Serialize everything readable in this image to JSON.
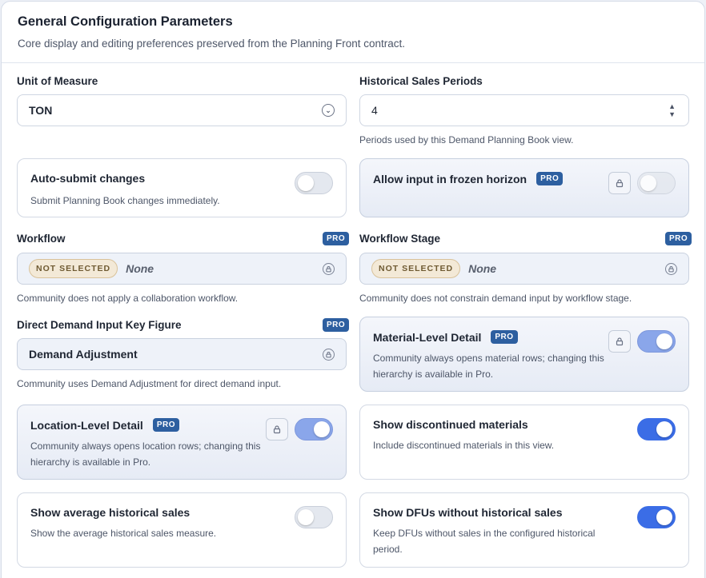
{
  "header": {
    "title": "General Configuration Parameters",
    "subtitle": "Core display and editing preferences preserved from the Planning Front contract."
  },
  "pro_label": "PRO",
  "unit_of_measure": {
    "label": "Unit of Measure",
    "value": "TON"
  },
  "historical_sales_periods": {
    "label": "Historical Sales Periods",
    "value": "4",
    "help": "Periods used by this Demand Planning Book view."
  },
  "auto_submit": {
    "title": "Auto-submit changes",
    "desc": "Submit Planning Book changes immediately.",
    "enabled": false
  },
  "frozen_horizon": {
    "title": "Allow input in frozen horizon",
    "enabled": false,
    "locked": true
  },
  "workflow": {
    "label": "Workflow",
    "status": "NOT SELECTED",
    "value": "None",
    "help": "Community does not apply a collaboration workflow."
  },
  "workflow_stage": {
    "label": "Workflow Stage",
    "status": "NOT SELECTED",
    "value": "None",
    "help": "Community does not constrain demand input by workflow stage."
  },
  "direct_demand": {
    "label": "Direct Demand Input Key Figure",
    "value": "Demand Adjustment",
    "help": "Community uses Demand Adjustment for direct demand input."
  },
  "material_level": {
    "title": "Material-Level Detail",
    "desc": "Community always opens material rows; changing this hierarchy is available in Pro.",
    "enabled": true,
    "locked": true
  },
  "location_level": {
    "title": "Location-Level Detail",
    "desc": "Community always opens location rows; changing this hierarchy is available in Pro.",
    "enabled": true,
    "locked": true
  },
  "show_discontinued": {
    "title": "Show discontinued materials",
    "desc": "Include discontinued materials in this view.",
    "enabled": true
  },
  "show_average": {
    "title": "Show average historical sales",
    "desc": "Show the average historical sales measure.",
    "enabled": false
  },
  "show_dfus": {
    "title": "Show DFUs without historical sales",
    "desc": "Keep DFUs without sales in the configured historical period.",
    "enabled": true
  },
  "colors": {
    "accent": "#3b6de6",
    "pro_badge": "#2d5fa0",
    "not_selected_bg": "#f3e9d7"
  }
}
